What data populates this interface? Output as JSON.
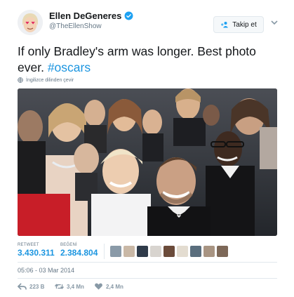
{
  "user": {
    "display_name": "Ellen DeGeneres",
    "handle": "@TheEllenShow",
    "verified": true,
    "avatar_icon": "heart-eyes-emoji-avatar"
  },
  "follow_button": {
    "label": "Takip et",
    "icon": "add-user-icon"
  },
  "more_menu": {
    "icon": "chevron-down-icon"
  },
  "tweet": {
    "text_before": "If only Bradley's arm was longer. Best photo ever. ",
    "hashtag": "#oscars",
    "translate_label": "İngilizce dilinden çevir"
  },
  "photo": {
    "subject": "oscars-group-selfie-photo"
  },
  "stats": {
    "retweets_label": "RETWEET",
    "retweets_value": "3.430.311",
    "likes_label": "BEĞENİ",
    "likes_value": "2.384.804"
  },
  "liker_avatars": [
    "#8a9aa8",
    "#c9b8a6",
    "#2f3b4a",
    "#d8d4cf",
    "#6b4b3a",
    "#e3dcd0",
    "#5a6e7d",
    "#a89482",
    "#7d6858"
  ],
  "timestamp": "05:06 - 03 Mar 2014",
  "actions": {
    "reply_count": "223 B",
    "retweet_count": "3,4 Mn",
    "like_count": "2,4 Mn"
  },
  "colors": {
    "link": "#1b95e0",
    "verified": "#1da1f2",
    "muted": "#657786"
  }
}
